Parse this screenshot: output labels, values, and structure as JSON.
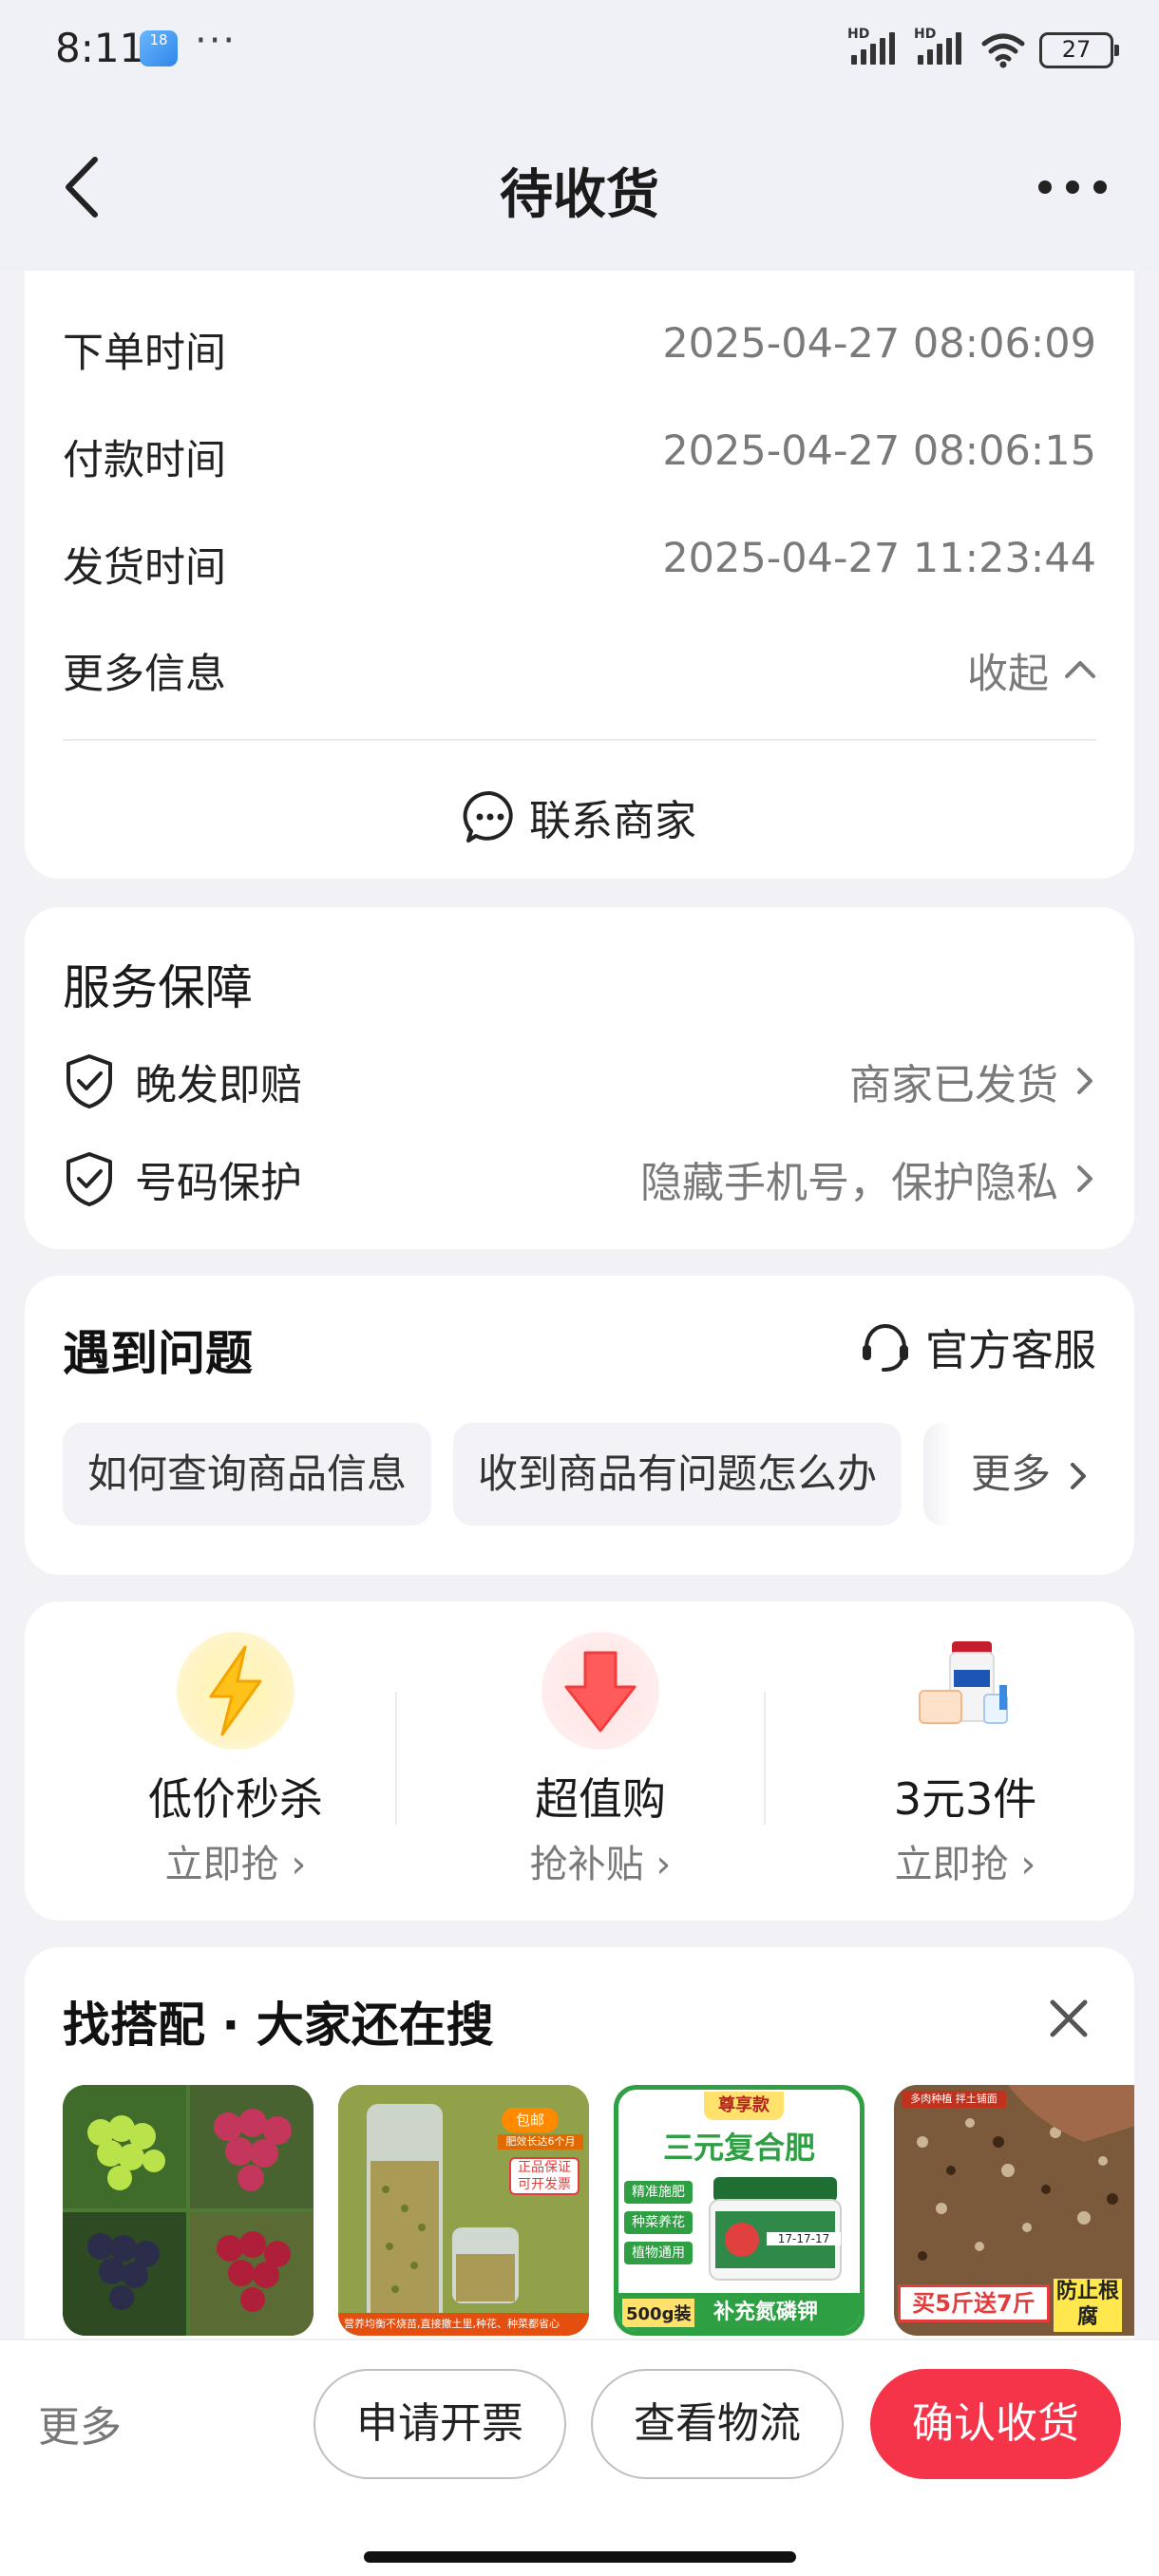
{
  "status_bar": {
    "time": "8:11",
    "app_badge": "18",
    "more": "···",
    "network_1": "HD",
    "network_2": "HD",
    "battery": "27"
  },
  "nav": {
    "title": "待收货",
    "back_icon": "chevron-left-icon",
    "more_icon": "more-dots-icon"
  },
  "order_info": {
    "rows": [
      {
        "label": "下单时间",
        "value": "2025-04-27 08:06:09"
      },
      {
        "label": "付款时间",
        "value": "2025-04-27 08:06:15"
      },
      {
        "label": "发货时间",
        "value": "2025-04-27 11:23:44"
      },
      {
        "label": "更多信息",
        "value": "收起"
      }
    ],
    "contact_label": "联系商家"
  },
  "service": {
    "title": "服务保障",
    "items": [
      {
        "label": "晚发即赔",
        "value": "商家已发货"
      },
      {
        "label": "号码保护",
        "value": "隐藏手机号，保护隐私"
      }
    ]
  },
  "problems": {
    "title": "遇到问题",
    "customer_service": "官方客服",
    "chips": [
      "如何查询商品信息",
      "收到商品有问题怎么办"
    ],
    "more": "更多"
  },
  "promos": [
    {
      "title": "低价秒杀",
      "sub": "立即抢",
      "icon": "lightning-icon"
    },
    {
      "title": "超值购",
      "sub": "抢补贴",
      "icon": "down-arrow-icon"
    },
    {
      "title": "3元3件",
      "sub": "立即抢",
      "icon": "products-icon"
    }
  ],
  "matching": {
    "title": "找搭配 · 大家还在搜",
    "products": [
      {
        "name": "grapes-product"
      },
      {
        "name": "seeds-jar-product",
        "badge_1": "包邮",
        "badge_2": "肥效长达6个月",
        "badge_3": "正品保证",
        "badge_4": "可开发票",
        "caption": "营养均衡不烧苗,直接撒土里,种花、种菜都省心"
      },
      {
        "name": "fertilizer-product",
        "tag": "尊享款",
        "headline": "三元复合肥",
        "f1": "精准施肥",
        "f2": "种菜养花",
        "f3": "植物通用",
        "size": "500g装",
        "bottom": "补充氮磷钾",
        "ratio": "17-17-17"
      },
      {
        "name": "soil-product",
        "top": "多肉种植 拌土铺面",
        "offer": "买5斤送7斤",
        "side": "防止根腐"
      }
    ]
  },
  "bottom_bar": {
    "more": "更多",
    "invoice": "申请开票",
    "logistics": "查看物流",
    "confirm": "确认收货"
  },
  "colors": {
    "primary": "#f5344a",
    "background": "#f2f2f6",
    "secondary_text": "#7a7a7a"
  }
}
